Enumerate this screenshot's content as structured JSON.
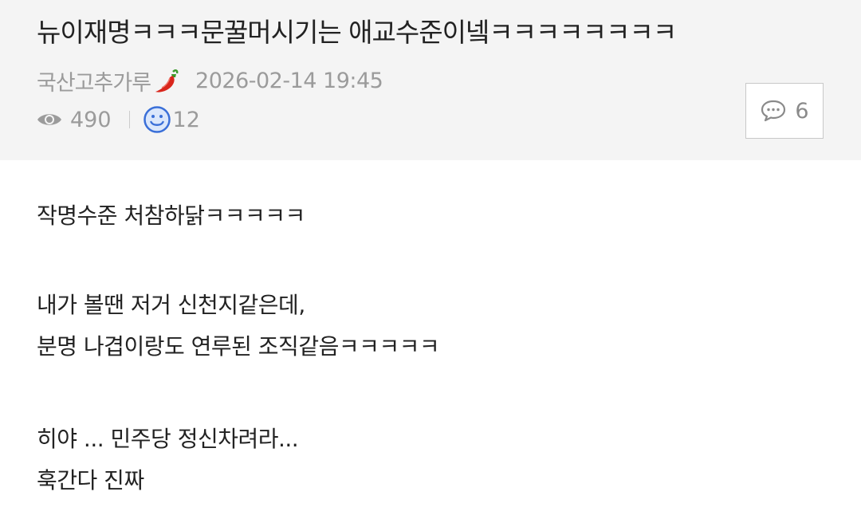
{
  "post": {
    "title": "뉴이재명ㅋㅋㅋ문꿀머시기는 애교수준이넼ㅋㅋㅋㅋㅋㅋㅋㅋ",
    "author": "국산고추가루",
    "author_badge_icon": "chili-pepper-icon",
    "datetime": "2026-02-14 19:45",
    "views": "490",
    "likes": "12",
    "comments": "6"
  },
  "content": {
    "line1": "작명수준 처참하닭ㅋㅋㅋㅋㅋ",
    "line2": "내가 볼땐 저거 신천지같은데,",
    "line3": "분명 나겹이랑도 연루된 조직같음ㅋㅋㅋㅋㅋ",
    "line4": "히야 ... 민주당 정신차려라...",
    "line5": "훅간다 진짜"
  },
  "colors": {
    "header_bg": "#f4f4f4",
    "meta_text": "#9b9b9b",
    "title_text": "#222222",
    "smile_blue": "#3a6fd8",
    "pepper_red": "#d9261c"
  }
}
